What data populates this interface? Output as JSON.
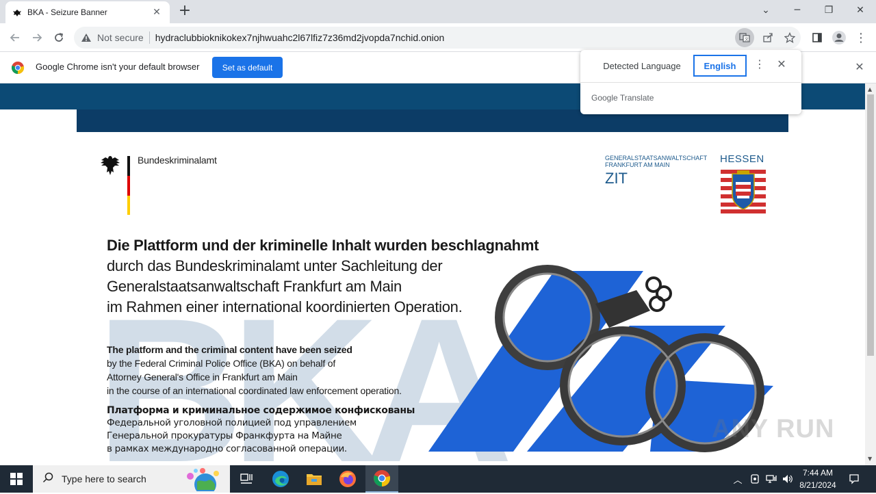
{
  "browser": {
    "tab_title": "BKA - Seizure Banner",
    "security_label": "Not secure",
    "url": "hydraclubbioknikokex7njhwuahc2l67lfiz7z36md2jvopda7nchid.onion"
  },
  "infobar": {
    "message": "Google Chrome isn't your default browser",
    "button_label": "Set as default"
  },
  "translate_popup": {
    "detected_label": "Detected Language",
    "target_label": "English",
    "brand": "Google Translate"
  },
  "page": {
    "bka_name": "Bundeskriminalamt",
    "gsa_line1": "GENERALSTAATSANWALTSCHAFT",
    "gsa_line2": "FRANKFURT AM MAIN",
    "zit": "ZIT",
    "hessen": "HESSEN",
    "de_title": "Die Plattform und der kriminelle Inhalt wurden beschlagnahmt",
    "de_lines": [
      "durch das Bundeskriminalamt unter Sachleitung der",
      "Generalstaatsanwaltschaft Frankfurt am Main",
      "im Rahmen einer international koordinierten Operation."
    ],
    "en_title": "The platform and the criminal content have been seized",
    "en_lines": [
      "by the Federal Criminal Police Office (BKA) on behalf of",
      "Attorney General's Office in Frankfurt am Main",
      "in the course of an international coordinated law enforcement operation."
    ],
    "ru_title": "Платформа и криминальное содержимое конфискованы",
    "ru_lines": [
      "Федеральной уголовной полицией под управлением",
      "Генеральной прокуратуры Франкфурта на Майне",
      "в рамках международно согласованной операции."
    ],
    "watermark": "ANY RUN"
  },
  "taskbar": {
    "search_placeholder": "Type here to search",
    "time": "7:44 AM",
    "date": "8/21/2024"
  },
  "colors": {
    "band_top": "#0c4a75",
    "band_inner": "#0c3c66",
    "accent_blue": "#1a73e8",
    "bka_watermark": "#d2dde8",
    "logo_blue": "#1e63d6",
    "taskbar": "#1f2a36"
  }
}
